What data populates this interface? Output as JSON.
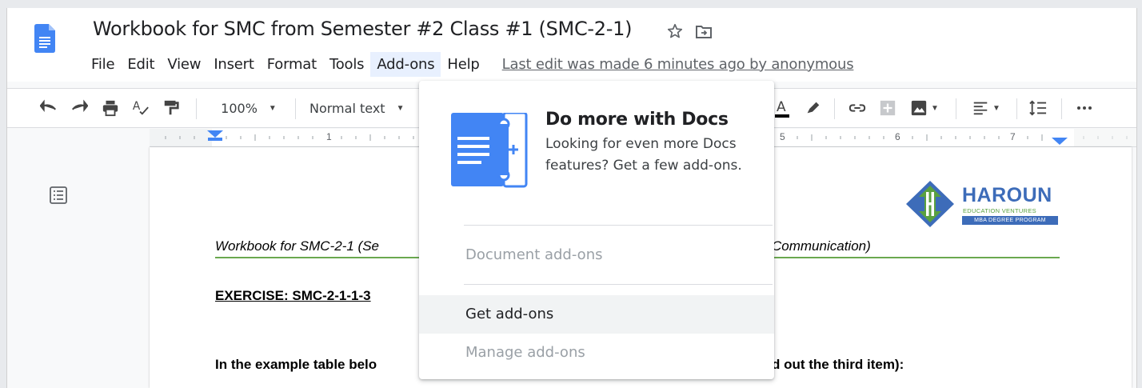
{
  "document": {
    "title": "Workbook for SMC from Semester #2 Class #1 (SMC-2-1)",
    "last_edit": "Last edit was made 6 minutes ago by anonymous"
  },
  "menu": [
    {
      "label": "File"
    },
    {
      "label": "Edit"
    },
    {
      "label": "View"
    },
    {
      "label": "Insert"
    },
    {
      "label": "Format"
    },
    {
      "label": "Tools"
    },
    {
      "label": "Add-ons",
      "active": true
    },
    {
      "label": "Help"
    }
  ],
  "toolbar": {
    "zoom": "100%",
    "style": "Normal text",
    "icons": [
      "undo-icon",
      "redo-icon",
      "print-icon",
      "spellcheck-icon",
      "paint-format-icon",
      "text-color-icon",
      "highlight-icon",
      "link-icon",
      "comment-icon",
      "image-icon",
      "align-icon",
      "line-spacing-icon",
      "more-icon"
    ]
  },
  "ruler": {
    "labels": [
      "1",
      "5",
      "6",
      "7"
    ]
  },
  "page": {
    "header_left": "Workbook for SMC-2-1 (Se",
    "header_right": "Communication)",
    "exercise": "EXERCISE: SMC-2-1-1-3",
    "instruction_left": "In the example table belo",
    "instruction_right": "d out the third item):",
    "logo": {
      "name": "HAROUN",
      "sub1": "EDUCATION VENTURES",
      "sub2": "MBA DEGREE PROGRAM",
      "colors": {
        "primary": "#3d6cb9",
        "accent": "#5aa13f"
      }
    }
  },
  "addons_dropdown": {
    "heading": "Do more with Docs",
    "description": "Looking for even more Docs features? Get a few add-ons.",
    "items": [
      {
        "label": "Document add-ons",
        "state": "disabled"
      },
      {
        "label": "Get add-ons",
        "state": "hover"
      },
      {
        "label": "Manage add-ons",
        "state": "disabled"
      }
    ]
  },
  "colors": {
    "docs_blue": "#4285f4",
    "menu_active_bg": "#e8f0fe",
    "green_rule": "#6aa84f"
  }
}
